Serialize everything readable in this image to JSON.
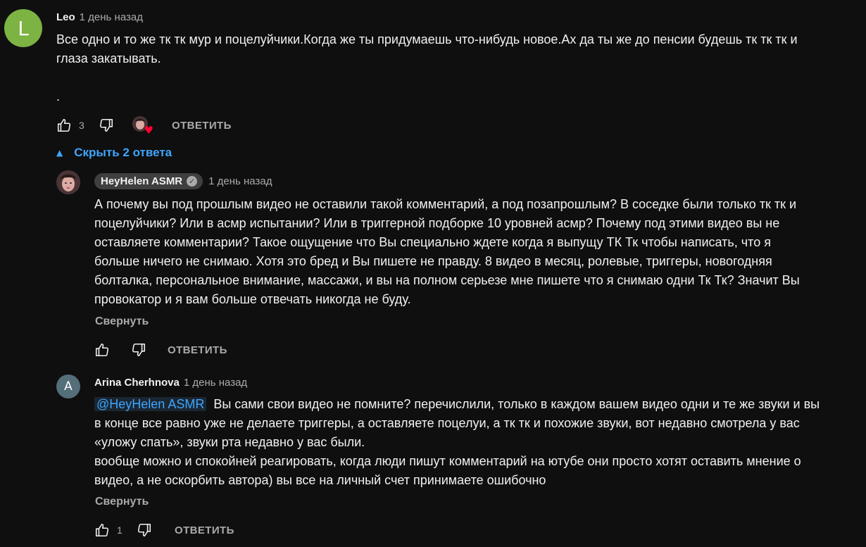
{
  "comments": [
    {
      "avatar_letter": "L",
      "avatar_color": "#7cb342",
      "author": "Leo",
      "time": "1 день назад",
      "text": "Все одно и то же тк тк мур и поцелуйчики.Когда же ты придумаешь что-нибудь новое.Ах да ты же до пенсии будешь тк тк тк и\nглаза закатывать.\n\n.",
      "likes": "3",
      "heart_icon": "creator-heart-icon",
      "reply_label": "ОТВЕТИТЬ",
      "replies_toggle": "Скрыть 2 ответа",
      "replies": [
        {
          "author": "HeyHelen ASMR",
          "verified": true,
          "time": "1 день назад",
          "text": "А почему вы под прошлым видео не оставили такой комментарий, а под позапрошлым? В соседке были только тк тк и\nпоцелуйчики? Или в асмр испытании? Или в триггерной подборке 10 уровней асмр? Почему под этими видео вы не\nоставляете комментарии? Такое ощущение что Вы специально ждете когда я выпущу ТК Тк чтобы написать, что я\nбольше ничего не снимаю. Хотя это бред и Вы пишете не правду. 8 видео в месяц, ролевые, триггеры, новогодняя\nболталка, персональное внимание, массажи, и вы на полном серьезе мне пишете что я снимаю одни Тк Тк? Значит Вы\nпровокатор и я вам больше отвечать никогда не буду.",
          "collapse_label": "Свернуть",
          "likes": "",
          "reply_label": "ОТВЕТИТЬ"
        },
        {
          "avatar_letter": "A",
          "avatar_color": "#546e7a",
          "author": "Arina Cherhnova",
          "time": "1 день назад",
          "mention": "@HeyHelen ASMR",
          "text": "  Вы сами свои видео не помните? перечислили, только в каждом вашем видео одни и те же звуки и вы\nв конце все равно уже не делаете триггеры, а оставляете поцелуи, а тк тк и похожие звуки, вот недавно смотрела у вас\n«уложу спать», звуки рта недавно у вас были.\nвообще можно и спокойней реагировать, когда люди пишут комментарий на ютубе они просто хотят оставить мнение о\nвидео, а не оскорбить автора) вы все на личный счет принимаете ошибочно",
          "collapse_label": "Свернуть",
          "likes": "1",
          "reply_label": "ОТВЕТИТЬ"
        }
      ]
    }
  ]
}
